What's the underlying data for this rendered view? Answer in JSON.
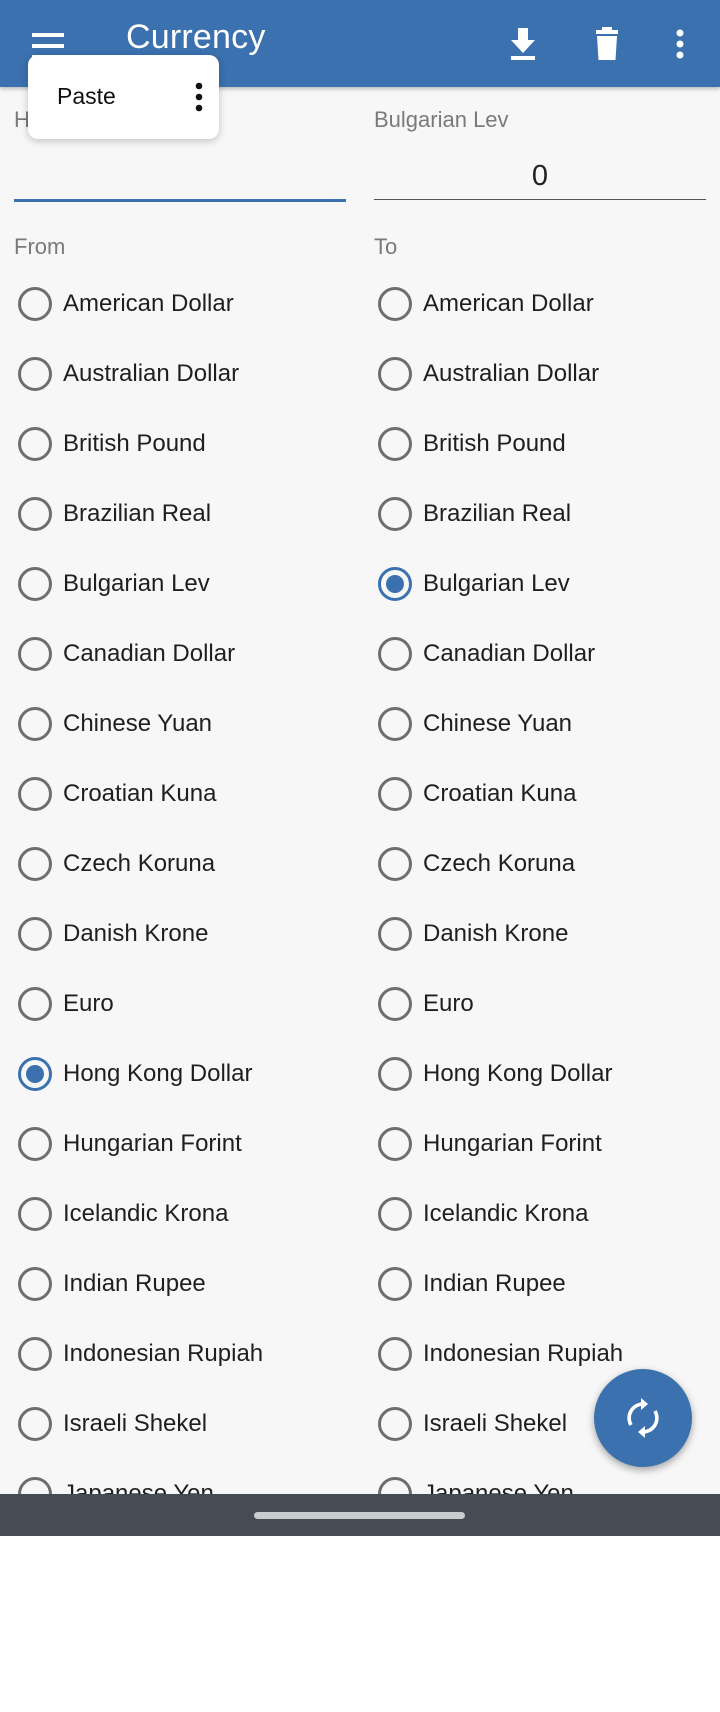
{
  "appbar": {
    "title": "Currency",
    "icons": [
      "menu-icon",
      "download-icon",
      "delete-icon",
      "more-vert-icon"
    ],
    "color": "#3b71ae"
  },
  "popup": {
    "paste_label": "Paste"
  },
  "from_field": {
    "label": "H",
    "value": ""
  },
  "to_field": {
    "label": "Bulgarian Lev",
    "value": "0"
  },
  "headers": {
    "from": "From",
    "to": "To"
  },
  "currencies": [
    "American Dollar",
    "Australian Dollar",
    "British Pound",
    "Brazilian Real",
    "Bulgarian Lev",
    "Canadian Dollar",
    "Chinese Yuan",
    "Croatian Kuna",
    "Czech Koruna",
    "Danish Krone",
    "Euro",
    "Hong Kong Dollar",
    "Hungarian Forint",
    "Icelandic Krona",
    "Indian Rupee",
    "Indonesian Rupiah",
    "Israeli Shekel",
    "Japanese Yen"
  ],
  "from_selected": "Hong Kong Dollar",
  "to_selected": "Bulgarian Lev",
  "fab_icon": "swap-refresh-icon"
}
